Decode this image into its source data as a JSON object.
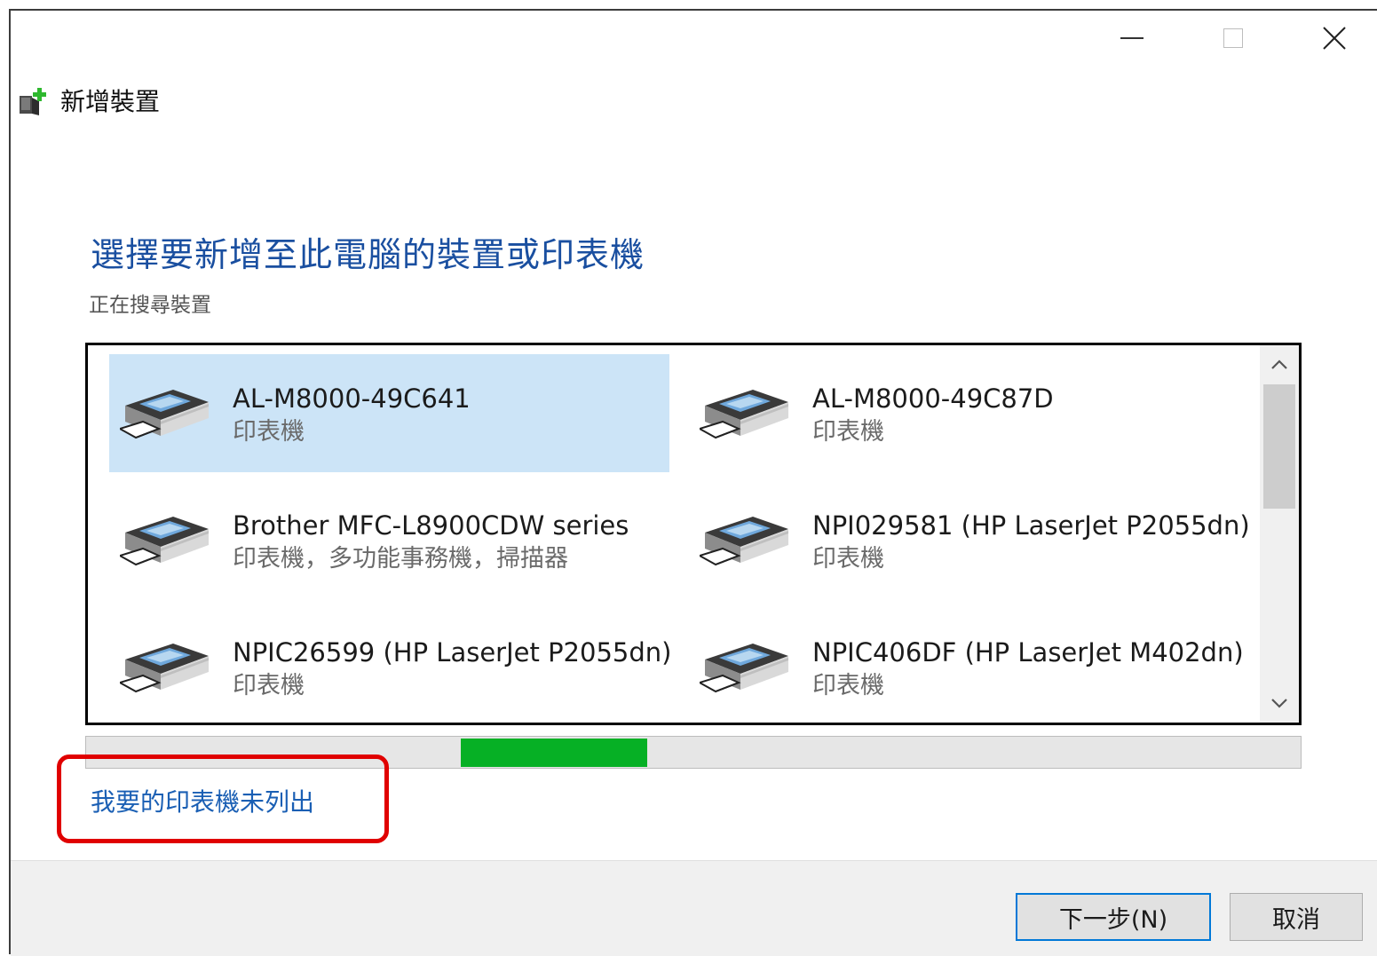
{
  "window": {
    "title": "新增裝置",
    "icons": {
      "app": "add-device-icon",
      "minimize": "minimize-icon",
      "maximize": "maximize-icon",
      "close": "close-icon"
    }
  },
  "main": {
    "heading": "選擇要新增至此電腦的裝置或印表機",
    "status": "正在搜尋裝置"
  },
  "devices": [
    {
      "name": "AL-M8000-49C641",
      "type": "印表機",
      "selected": true,
      "icon": "printer-icon"
    },
    {
      "name": "AL-M8000-49C87D",
      "type": "印表機",
      "selected": false,
      "icon": "printer-icon"
    },
    {
      "name": "Brother MFC-L8900CDW series",
      "type": "印表機，多功能事務機，掃描器",
      "selected": false,
      "icon": "printer-icon"
    },
    {
      "name": "NPI029581 (HP LaserJet P2055dn)",
      "type": "印表機",
      "selected": false,
      "icon": "printer-icon"
    },
    {
      "name": "NPIC26599 (HP LaserJet P2055dn)",
      "type": "印表機",
      "selected": false,
      "icon": "printer-icon"
    },
    {
      "name": "NPIC406DF (HP LaserJet M402dn)",
      "type": "印表機",
      "selected": false,
      "icon": "printer-icon"
    }
  ],
  "link": {
    "label": "我要的印表機未列出"
  },
  "buttons": {
    "next": "下一步(N)",
    "cancel": "取消"
  },
  "colors": {
    "heading": "#1a4fa0",
    "selection": "#cce4f7",
    "progress": "#06b025",
    "highlight_box": "#e00000",
    "link": "#1a5fb4"
  }
}
